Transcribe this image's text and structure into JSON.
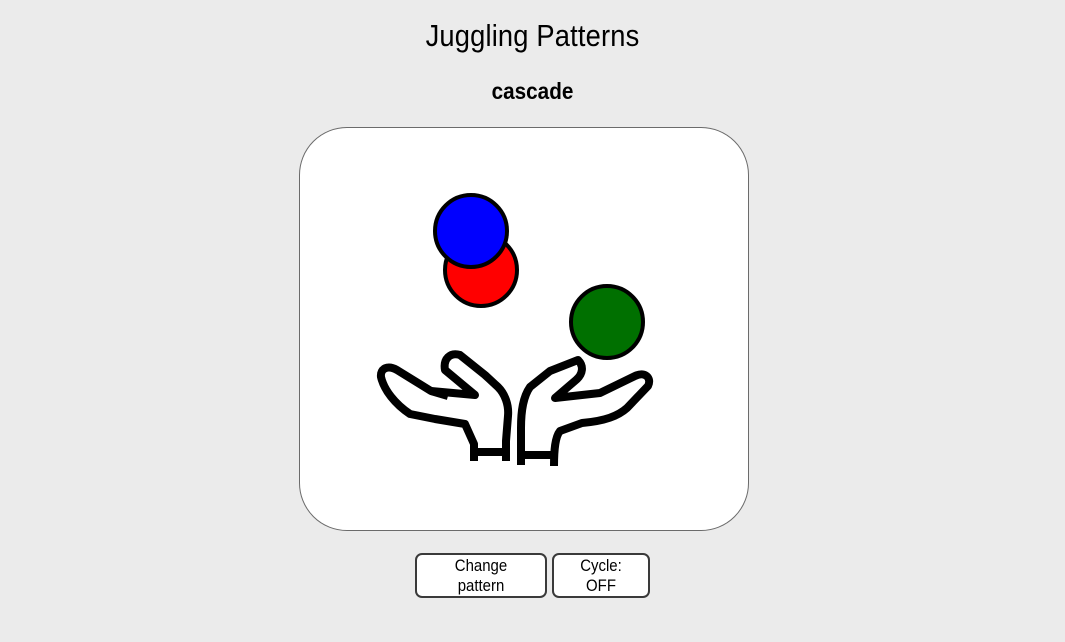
{
  "page": {
    "title": "Juggling Patterns",
    "pattern_name": "cascade"
  },
  "stage": {
    "balls": [
      {
        "name": "red-ball",
        "color": "#ff0000"
      },
      {
        "name": "blue-ball",
        "color": "#0000ff"
      },
      {
        "name": "green-ball",
        "color": "#007000"
      }
    ],
    "icon": "juggling-hands-icon"
  },
  "controls": {
    "change_pattern_label": "Change pattern",
    "cycle_label": "Cycle: OFF"
  }
}
